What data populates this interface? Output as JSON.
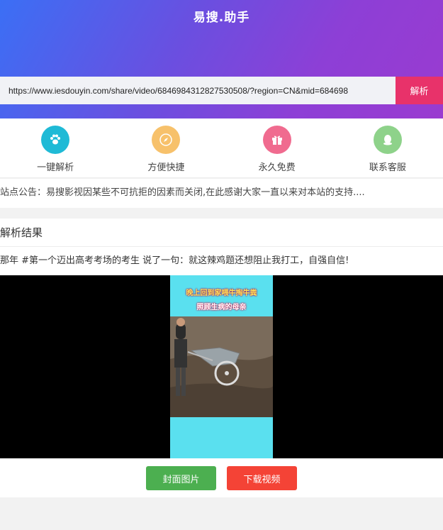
{
  "header": {
    "brand": "易搜.助手"
  },
  "search": {
    "value": "https://www.iesdouyin.com/share/video/6846984312827530508/?region=CN&mid=684698",
    "button": "解析"
  },
  "features": [
    {
      "label": "一键解析",
      "icon": "paw-icon",
      "color": "#1fbad6"
    },
    {
      "label": "方便快捷",
      "icon": "compass-icon",
      "color": "#f7c16b"
    },
    {
      "label": "永久免费",
      "icon": "gift-icon",
      "color": "#f06b8f"
    },
    {
      "label": "联系客服",
      "icon": "qq-icon",
      "color": "#8ed28a"
    }
  ],
  "notice": {
    "text": "站点公告：易搜影视因某些不可抗拒的因素而关闭,在此感谢大家一直以来对本站的支持...."
  },
  "result": {
    "title": "解析结果",
    "description": "那年 #第一个迈出高考考场的考生 说了一句：就这辣鸡题还想阻止我打工，自强自信!",
    "caption_line1": "晚上回到家喂牛掏牛粪",
    "caption_line2": "照顾生病的母亲"
  },
  "actions": {
    "cover": "封面图片",
    "download": "下载视频"
  },
  "colors": {
    "accent": "#e8326a",
    "cover_btn": "#4caf50",
    "download_btn": "#f44336"
  }
}
